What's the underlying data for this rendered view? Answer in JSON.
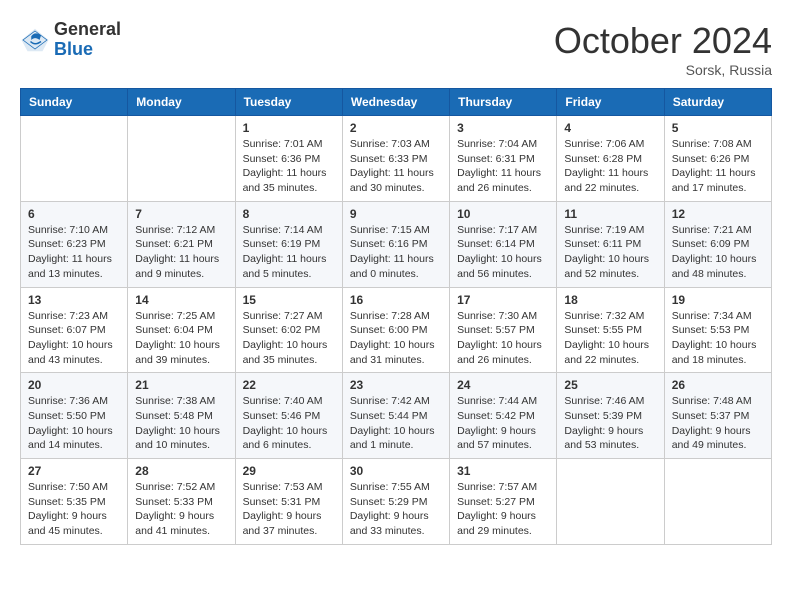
{
  "logo": {
    "general": "General",
    "blue": "Blue"
  },
  "title": "October 2024",
  "location": "Sorsk, Russia",
  "days_header": [
    "Sunday",
    "Monday",
    "Tuesday",
    "Wednesday",
    "Thursday",
    "Friday",
    "Saturday"
  ],
  "weeks": [
    [
      {
        "day": "",
        "info": ""
      },
      {
        "day": "",
        "info": ""
      },
      {
        "day": "1",
        "info": "Sunrise: 7:01 AM\nSunset: 6:36 PM\nDaylight: 11 hours and 35 minutes."
      },
      {
        "day": "2",
        "info": "Sunrise: 7:03 AM\nSunset: 6:33 PM\nDaylight: 11 hours and 30 minutes."
      },
      {
        "day": "3",
        "info": "Sunrise: 7:04 AM\nSunset: 6:31 PM\nDaylight: 11 hours and 26 minutes."
      },
      {
        "day": "4",
        "info": "Sunrise: 7:06 AM\nSunset: 6:28 PM\nDaylight: 11 hours and 22 minutes."
      },
      {
        "day": "5",
        "info": "Sunrise: 7:08 AM\nSunset: 6:26 PM\nDaylight: 11 hours and 17 minutes."
      }
    ],
    [
      {
        "day": "6",
        "info": "Sunrise: 7:10 AM\nSunset: 6:23 PM\nDaylight: 11 hours and 13 minutes."
      },
      {
        "day": "7",
        "info": "Sunrise: 7:12 AM\nSunset: 6:21 PM\nDaylight: 11 hours and 9 minutes."
      },
      {
        "day": "8",
        "info": "Sunrise: 7:14 AM\nSunset: 6:19 PM\nDaylight: 11 hours and 5 minutes."
      },
      {
        "day": "9",
        "info": "Sunrise: 7:15 AM\nSunset: 6:16 PM\nDaylight: 11 hours and 0 minutes."
      },
      {
        "day": "10",
        "info": "Sunrise: 7:17 AM\nSunset: 6:14 PM\nDaylight: 10 hours and 56 minutes."
      },
      {
        "day": "11",
        "info": "Sunrise: 7:19 AM\nSunset: 6:11 PM\nDaylight: 10 hours and 52 minutes."
      },
      {
        "day": "12",
        "info": "Sunrise: 7:21 AM\nSunset: 6:09 PM\nDaylight: 10 hours and 48 minutes."
      }
    ],
    [
      {
        "day": "13",
        "info": "Sunrise: 7:23 AM\nSunset: 6:07 PM\nDaylight: 10 hours and 43 minutes."
      },
      {
        "day": "14",
        "info": "Sunrise: 7:25 AM\nSunset: 6:04 PM\nDaylight: 10 hours and 39 minutes."
      },
      {
        "day": "15",
        "info": "Sunrise: 7:27 AM\nSunset: 6:02 PM\nDaylight: 10 hours and 35 minutes."
      },
      {
        "day": "16",
        "info": "Sunrise: 7:28 AM\nSunset: 6:00 PM\nDaylight: 10 hours and 31 minutes."
      },
      {
        "day": "17",
        "info": "Sunrise: 7:30 AM\nSunset: 5:57 PM\nDaylight: 10 hours and 26 minutes."
      },
      {
        "day": "18",
        "info": "Sunrise: 7:32 AM\nSunset: 5:55 PM\nDaylight: 10 hours and 22 minutes."
      },
      {
        "day": "19",
        "info": "Sunrise: 7:34 AM\nSunset: 5:53 PM\nDaylight: 10 hours and 18 minutes."
      }
    ],
    [
      {
        "day": "20",
        "info": "Sunrise: 7:36 AM\nSunset: 5:50 PM\nDaylight: 10 hours and 14 minutes."
      },
      {
        "day": "21",
        "info": "Sunrise: 7:38 AM\nSunset: 5:48 PM\nDaylight: 10 hours and 10 minutes."
      },
      {
        "day": "22",
        "info": "Sunrise: 7:40 AM\nSunset: 5:46 PM\nDaylight: 10 hours and 6 minutes."
      },
      {
        "day": "23",
        "info": "Sunrise: 7:42 AM\nSunset: 5:44 PM\nDaylight: 10 hours and 1 minute."
      },
      {
        "day": "24",
        "info": "Sunrise: 7:44 AM\nSunset: 5:42 PM\nDaylight: 9 hours and 57 minutes."
      },
      {
        "day": "25",
        "info": "Sunrise: 7:46 AM\nSunset: 5:39 PM\nDaylight: 9 hours and 53 minutes."
      },
      {
        "day": "26",
        "info": "Sunrise: 7:48 AM\nSunset: 5:37 PM\nDaylight: 9 hours and 49 minutes."
      }
    ],
    [
      {
        "day": "27",
        "info": "Sunrise: 7:50 AM\nSunset: 5:35 PM\nDaylight: 9 hours and 45 minutes."
      },
      {
        "day": "28",
        "info": "Sunrise: 7:52 AM\nSunset: 5:33 PM\nDaylight: 9 hours and 41 minutes."
      },
      {
        "day": "29",
        "info": "Sunrise: 7:53 AM\nSunset: 5:31 PM\nDaylight: 9 hours and 37 minutes."
      },
      {
        "day": "30",
        "info": "Sunrise: 7:55 AM\nSunset: 5:29 PM\nDaylight: 9 hours and 33 minutes."
      },
      {
        "day": "31",
        "info": "Sunrise: 7:57 AM\nSunset: 5:27 PM\nDaylight: 9 hours and 29 minutes."
      },
      {
        "day": "",
        "info": ""
      },
      {
        "day": "",
        "info": ""
      }
    ]
  ]
}
